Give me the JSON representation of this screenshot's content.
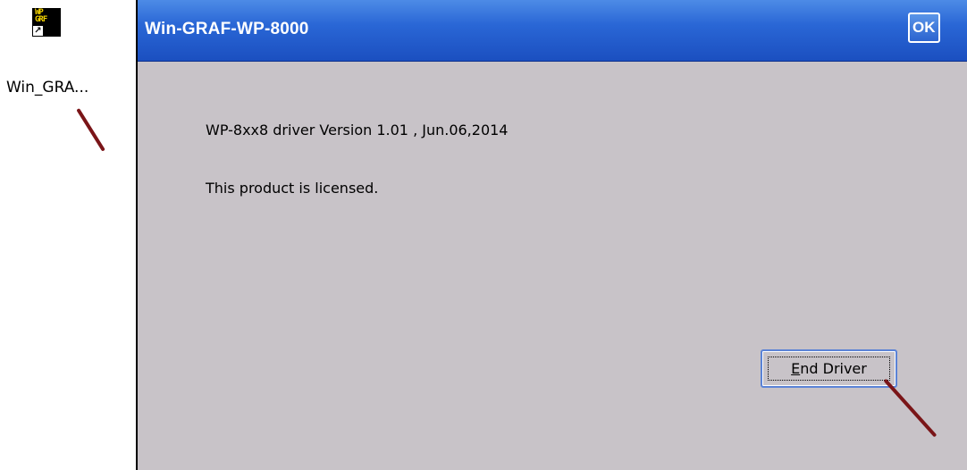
{
  "desktop": {
    "icon_logo_line1": "WP",
    "icon_logo_line2": "GRF",
    "shortcut_arrow": "↗",
    "icon_label": "Win_GRA..."
  },
  "window": {
    "title": "Win-GRAF-WP-8000",
    "ok_label": "OK",
    "driver_version_text": "WP-8xx8 driver Version 1.01 , Jun.06,2014",
    "license_text": "This product is licensed.",
    "end_button": {
      "accel": "E",
      "rest": "nd Driver"
    }
  },
  "colors": {
    "titlebar": "#2a67d6",
    "window_bg": "#c8c3c8",
    "annotation": "#7a1518"
  }
}
